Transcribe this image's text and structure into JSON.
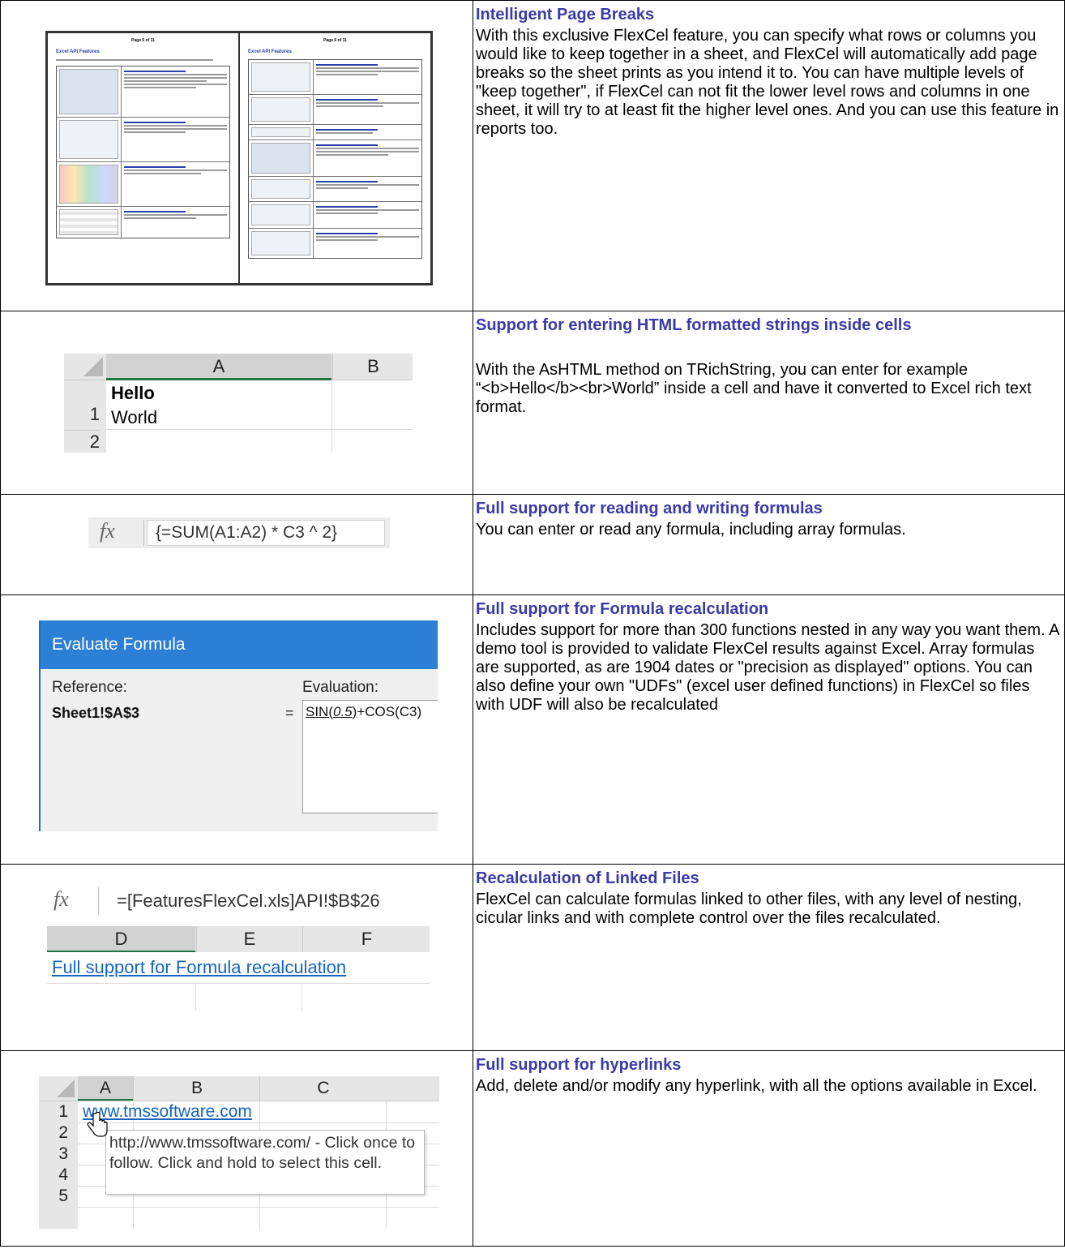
{
  "features": [
    {
      "title": "Intelligent Page Breaks",
      "description": "With this exclusive FlexCel feature, you can specify what rows or columns you would like to keep together in a sheet, and FlexCel will automatically add page breaks so the sheet prints as you intend it to. You can have multiple levels of \"keep together\", if FlexCel can not fit the lower level rows and columns in one sheet, it will try to at least fit the higher level ones. And you can use this feature in reports too."
    },
    {
      "title": "Support for entering HTML formatted strings inside cells",
      "description": "With the AsHTML method on TRichString, you can enter for example “<b>Hello</b><br>World” inside a cell and have it converted to Excel rich text format."
    },
    {
      "title": "Full support for reading and writing formulas",
      "description": "You can enter or read any formula, including array formulas."
    },
    {
      "title": "Full support for Formula recalculation",
      "description": "Includes support for more than 300 functions nested in any way you want them. A demo tool is provided to validate FlexCel results against Excel. Array formulas are supported, as are 1904 dates or \"precision as displayed\" options. You can also define your own \"UDFs\" (excel user defined functions) in FlexCel so files with UDF will also be recalculated"
    },
    {
      "title": "Recalculation of Linked Files",
      "description": "FlexCel can calculate formulas linked to other files, with any level of nesting, cicular links and with complete control over the files recalculated."
    },
    {
      "title": "Full support for hyperlinks",
      "description": "Add, delete and/or modify any hyperlink, with all the options available in Excel."
    }
  ],
  "thumbnails": {
    "left_page": {
      "page_label": "Page 5 of 11",
      "title": "Excel API Features"
    },
    "right_page": {
      "page_label": "Page 6 of 11",
      "title": "Excel API Features"
    }
  },
  "html_grid": {
    "col_a": "A",
    "col_b": "B",
    "row1": "1",
    "row2": "2",
    "cell_bold": "Hello",
    "cell_plain": "World"
  },
  "formula_bar": {
    "fx": "fx",
    "formula": "{=SUM(A1:A2) * C3 ^ 2}"
  },
  "evaluate_dialog": {
    "title": "Evaluate Formula",
    "reference_label": "Reference:",
    "evaluation_label": "Evaluation:",
    "reference_value": "Sheet1!$A$3",
    "equals": "=",
    "eval_sin": "SIN(",
    "eval_arg": "0.5",
    "eval_close": ")",
    "eval_rest": "+COS(C3)"
  },
  "linked_files": {
    "fx": "fx",
    "formula": "=[FeaturesFlexCel.xls]API!$B$26",
    "col_d": "D",
    "col_e": "E",
    "col_f": "F",
    "link_text": "Full support for Formula recalculation"
  },
  "hyperlinks": {
    "col_a": "A",
    "col_b": "B",
    "col_c": "C",
    "rows": [
      "1",
      "2",
      "3",
      "4",
      "5"
    ],
    "link_text": "www.tmssoftware.com",
    "tooltip": "http://www.tmssoftware.com/ - Click once to follow. Click and hold to select this cell."
  }
}
